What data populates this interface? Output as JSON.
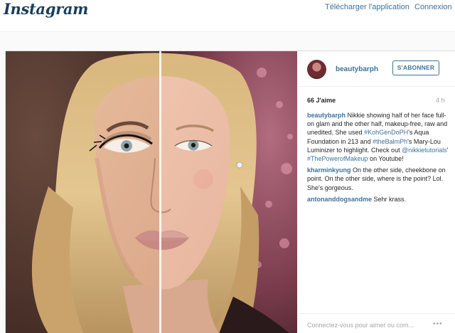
{
  "header": {
    "logo": "Instagram",
    "download_app": "Télécharger l'application",
    "login": "Connexion"
  },
  "post": {
    "username": "beautybarph",
    "follow_label": "S'ABONNER",
    "likes": "66 J'aime",
    "time": "4 h",
    "caption": {
      "user": "beautybarph",
      "parts": [
        {
          "text": "Nikkie showing half of her face full-on glam and the other half, makeup-free, raw and unedited. She used ",
          "tag": false
        },
        {
          "text": "#KohGenDoPH",
          "tag": true
        },
        {
          "text": "'s Aqua Foundation in 213 and ",
          "tag": false
        },
        {
          "text": "#theBalmPh",
          "tag": true
        },
        {
          "text": "'s Mary-Lou Luminizer to highlight. Check out ",
          "tag": false
        },
        {
          "text": "@nikkietutorials",
          "tag": true
        },
        {
          "text": "' ",
          "tag": false
        },
        {
          "text": "#ThePowerofMakeup",
          "tag": true
        },
        {
          "text": " on Youtube!",
          "tag": false
        }
      ]
    },
    "comments": [
      {
        "user": "kharminkyung",
        "text": "On the other side, cheekbone on point. On the other side, where is the point? Lol. She's gorgeous."
      },
      {
        "user": "antonanddogsandme",
        "text": "Sehr krass."
      }
    ],
    "footer_prompt": "Connectez-vous pour aimer ou com...",
    "more": "•••",
    "image_subject": "half-makeup-face-portrait"
  },
  "colors": {
    "link": "#3f729b",
    "text": "#262626",
    "muted": "#a5a7aa",
    "background": "#fafafa"
  }
}
